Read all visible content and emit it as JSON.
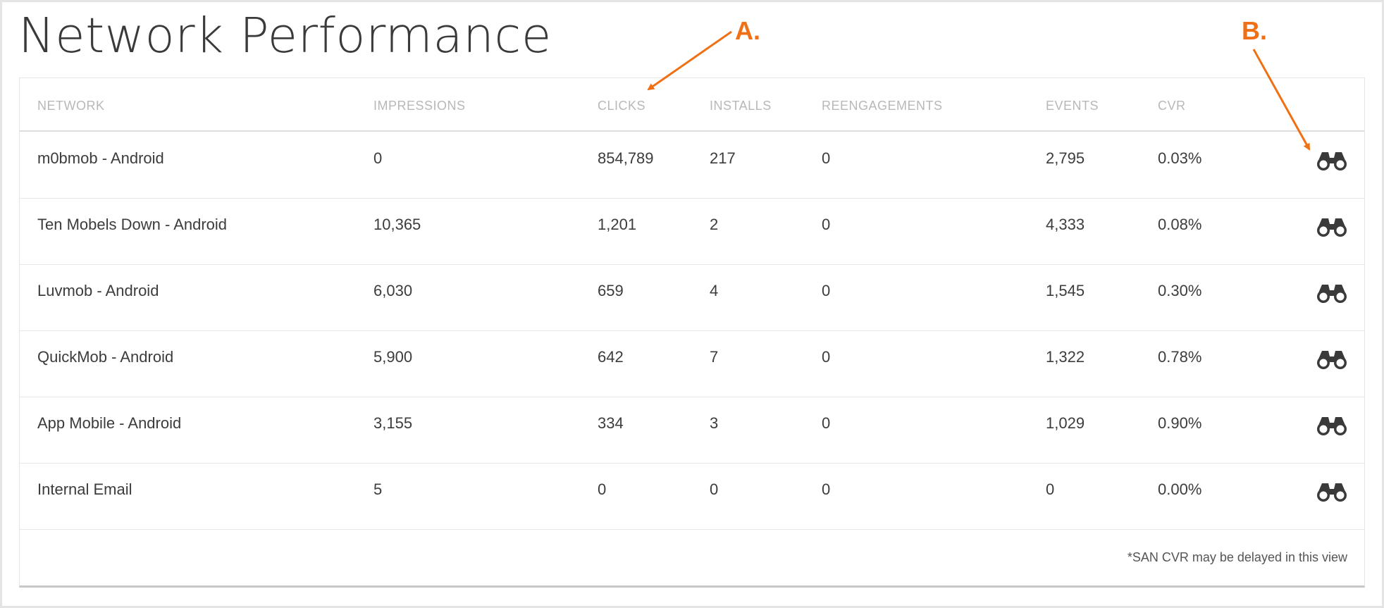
{
  "title": "Network Performance",
  "colors": {
    "annotation": "#f07016",
    "header_text": "#b8b8b8",
    "cell_text": "#3c3c3c",
    "icon": "#3a3a3a"
  },
  "table": {
    "columns": [
      "NETWORK",
      "IMPRESSIONS",
      "CLICKS",
      "INSTALLS",
      "REENGAGEMENTS",
      "EVENTS",
      "CVR"
    ],
    "rows": [
      [
        "m0bmob - Android",
        "0",
        "854,789",
        "217",
        "0",
        "2,795",
        "0.03%"
      ],
      [
        "Ten Mobels Down - Android",
        "10,365",
        "1,201",
        "2",
        "0",
        "4,333",
        "0.08%"
      ],
      [
        "Luvmob - Android",
        "6,030",
        "659",
        "4",
        "0",
        "1,545",
        "0.30%"
      ],
      [
        "QuickMob - Android",
        "5,900",
        "642",
        "7",
        "0",
        "1,322",
        "0.78%"
      ],
      [
        "App Mobile - Android",
        "3,155",
        "334",
        "3",
        "0",
        "1,029",
        "0.90%"
      ],
      [
        "Internal Email",
        "5",
        "0",
        "0",
        "0",
        "0",
        "0.00%"
      ]
    ],
    "row_action_icon": "binoculars-icon",
    "footnote": "*SAN CVR may be delayed in this view"
  },
  "annotations": {
    "a_label": "A.",
    "b_label": "B."
  }
}
